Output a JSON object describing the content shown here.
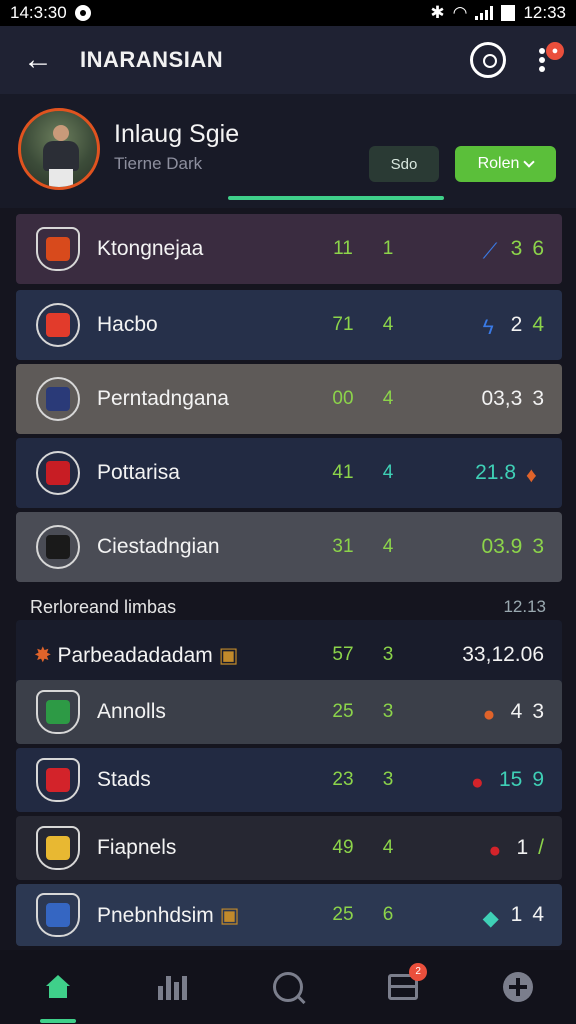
{
  "status_bar": {
    "time": "14:3:30",
    "right_time": "12:33"
  },
  "app_bar": {
    "title": "INARANSIAN"
  },
  "profile": {
    "name": "Inlaug Sgie",
    "subtitle": "Tierne Dark",
    "secondary_button": "Sdo",
    "primary_button": "Rolen"
  },
  "rows": [
    {
      "name": "Ktongnejaa",
      "c1": "11",
      "c2": "1",
      "p1": "3",
      "p2": "6",
      "bg": "#3a2c40",
      "crest": "#d84a1c"
    },
    {
      "name": "Hacbo",
      "c1": "71",
      "c2": "4",
      "p1": "2",
      "p2": "4",
      "bg": "#26304a",
      "crest": "#e23b2b"
    },
    {
      "name": "Perntadngana",
      "c1": "00",
      "c2": "4",
      "p1": "03,3",
      "p2": "3",
      "bg": "#5e5a58",
      "crest": "#2a3a78"
    },
    {
      "name": "Pottarisa",
      "c1": "41",
      "c2": "4",
      "p1": "21.8",
      "p2": "",
      "bg": "#222a42",
      "crest": "#c81d24"
    },
    {
      "name": "Ciestadngian",
      "c1": "31",
      "c2": "4",
      "p1": "03.9",
      "p2": "3",
      "bg": "#4a4c55",
      "crest": "#1a1a1a"
    }
  ],
  "section": {
    "label": "Rerloreand limbas",
    "right": "12.13"
  },
  "rows2": [
    {
      "name": "Parbeadadadam",
      "c1": "57",
      "c2": "3",
      "p1": "33,12.06",
      "p2": "",
      "bg": "#191c2b",
      "crest": "#c28a2b"
    },
    {
      "name": "Annolls",
      "c1": "25",
      "c2": "3",
      "p1": "4",
      "p2": "3",
      "bg": "#3b3f49",
      "crest": "#2d9a45"
    },
    {
      "name": "Stads",
      "c1": "23",
      "c2": "3",
      "p1": "15",
      "p2": "9",
      "bg": "#222a42",
      "crest": "#d3232a"
    },
    {
      "name": "Fiapnels",
      "c1": "49",
      "c2": "4",
      "p1": "1",
      "p2": "/",
      "bg": "#262732",
      "crest": "#e8b832"
    },
    {
      "name": "Pnebnhdsim",
      "c1": "25",
      "c2": "6",
      "p1": "1",
      "p2": "4",
      "bg": "#2c3852",
      "crest": "#3566c2"
    }
  ],
  "nav": {
    "home": "home-icon",
    "stats": "stats-icon",
    "search": "search-icon",
    "box_badge": "2",
    "add": "plus-icon"
  }
}
